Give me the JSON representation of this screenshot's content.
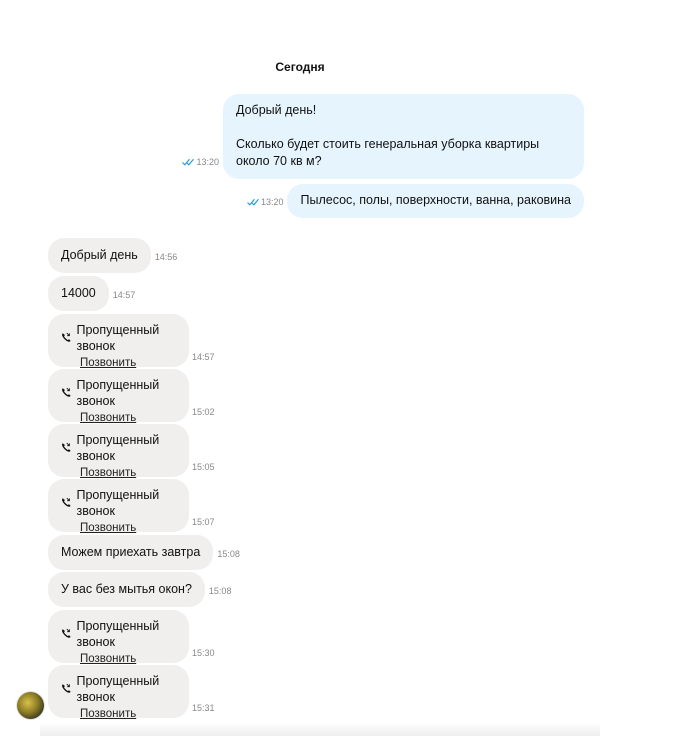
{
  "date_separator": "Сегодня",
  "outgoing": [
    {
      "line1": "Добрый день!",
      "line2": "Сколько будет стоить генеральная уборка квартиры около 70 кв м?",
      "time": "13:20"
    },
    {
      "text": "Пылесос, полы, поверхности, ванна, раковина",
      "time": "13:20"
    }
  ],
  "incoming": [
    {
      "text": "Добрый день",
      "time": "14:56"
    },
    {
      "text": "14000",
      "time": "14:57"
    },
    {
      "call_label": "Пропущенный звонок",
      "action": "Позвонить",
      "time": "14:57"
    },
    {
      "call_label": "Пропущенный звонок",
      "action": "Позвонить",
      "time": "15:02"
    },
    {
      "call_label": "Пропущенный звонок",
      "action": "Позвонить",
      "time": "15:05"
    },
    {
      "call_label": "Пропущенный звонок",
      "action": "Позвонить",
      "time": "15:07"
    },
    {
      "text": "Можем приехать завтра",
      "time": "15:08"
    },
    {
      "text": "У вас без мытья окон?",
      "time": "15:08"
    },
    {
      "call_label": "Пропущенный звонок",
      "action": "Позвонить",
      "time": "15:30"
    },
    {
      "call_label": "Пропущенный звонок",
      "action": "Позвонить",
      "time": "15:31"
    }
  ],
  "icons": {
    "read_receipt": "double-check-icon",
    "missed_call": "missed-call-icon"
  },
  "colors": {
    "outgoing_bubble": "#e6f4fd",
    "incoming_bubble": "#f0efed",
    "read_check": "#2a9bd6"
  }
}
